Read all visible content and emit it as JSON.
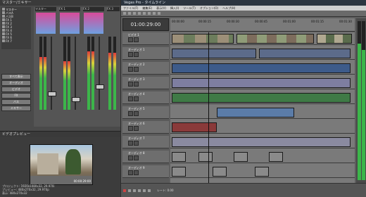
{
  "mixer": {
    "title": "マスター/ミキサー",
    "channels": [
      {
        "name": "マスター"
      },
      {
        "name": "FX 1"
      },
      {
        "name": "FX 2"
      },
      {
        "name": "FX 3"
      },
      {
        "name": "FX 4"
      }
    ],
    "channel_levels": [
      0.72,
      0.66,
      0.8,
      0.78,
      0.6
    ],
    "buttons": [
      "すべて表示",
      "オーディオ",
      "ビデオ",
      "FX",
      "バス",
      "ミキサー"
    ],
    "sidebar_items": [
      "マスター",
      "バスA",
      "バスB",
      "FX 1",
      "FX 2",
      "FX 3",
      "FX 4",
      "FX 5",
      "FX 6",
      "FX 7"
    ]
  },
  "preview": {
    "title": "ビデオプレビュー",
    "info_lines": [
      "プロジェクト: 1920x1080x32, 29.970i",
      "プレビュー: 480x270x32, 29.970p",
      "表示: 480x270x32"
    ],
    "timecode_overlay": "00:00:29:00"
  },
  "timeline": {
    "title": "Vegas Pro - タイムライン",
    "menu": [
      "ファイル(F)",
      "編集(E)",
      "表示(V)",
      "挿入(I)",
      "ツール(T)",
      "オプション(O)",
      "ヘルプ(H)"
    ],
    "timecode": "01:00:29:00",
    "ruler_labels": [
      "00:00:00",
      "00:00:15",
      "00:00:30",
      "00:00:45",
      "00:01:00",
      "00:01:15",
      "00:01:30"
    ],
    "tracks": [
      {
        "name": "ビデオ 1",
        "kind": "video"
      },
      {
        "name": "オーディオ 1",
        "kind": "audio"
      },
      {
        "name": "オーディオ 2",
        "kind": "audio"
      },
      {
        "name": "オーディオ 3",
        "kind": "audio"
      },
      {
        "name": "オーディオ 4",
        "kind": "audio"
      },
      {
        "name": "オーディオ 5",
        "kind": "audio"
      },
      {
        "name": "オーディオ 6",
        "kind": "audio"
      },
      {
        "name": "オーディオ 7",
        "kind": "audio"
      },
      {
        "name": "オーディオ 8",
        "kind": "audio"
      },
      {
        "name": "オーディオ 9",
        "kind": "audio"
      }
    ],
    "status_text": "レート: 0.00"
  },
  "colors": {
    "video_clip": "#8a8a8a",
    "audio_clip_blue": "#3d5b8a",
    "audio_clip_green": "#3f7a46",
    "audio_clip_red": "#8a3a3a",
    "meter_green": "#3cb64a",
    "meter_red": "#e03a3a"
  }
}
